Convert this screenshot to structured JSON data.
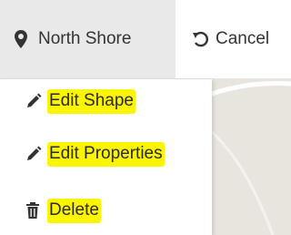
{
  "toolbar": {
    "location_label": "North Shore",
    "location_icon": "map-marker-icon",
    "cancel_label": "Cancel",
    "cancel_icon": "undo-icon"
  },
  "menu": {
    "items": [
      {
        "label": "Edit Shape",
        "icon": "pencil-icon"
      },
      {
        "label": "Edit Properties",
        "icon": "pencil-icon"
      },
      {
        "label": "Delete",
        "icon": "trash-icon"
      }
    ]
  },
  "colors": {
    "highlight": "#fbf402",
    "map_background": "#e8e5de",
    "toolbar_active": "#e9e9e9"
  }
}
